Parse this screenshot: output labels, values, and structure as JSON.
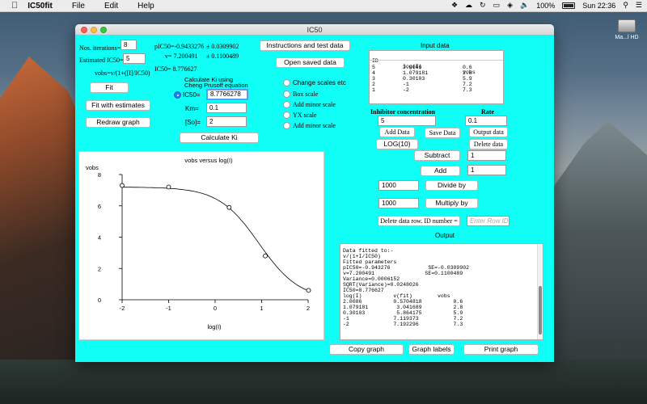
{
  "menubar": {
    "app_name": "IC50fit",
    "menus": [
      "File",
      "Edit",
      "Help"
    ],
    "battery": "100%",
    "clock": "Sun 22:36"
  },
  "desktop": {
    "disk_label": "Ma...l HD"
  },
  "window": {
    "title": "IC50",
    "nos_iterations_label": "Nos. iterations=",
    "nos_iterations_value": "8",
    "est_ic50_label": "Estimated IC50=",
    "est_ic50_value": "5",
    "pic50_text": "pIC50=-0.9433276",
    "pic50_se": "± 0.0309902",
    "v_text": "v= 7.200491",
    "v_se": "± 0.1100489",
    "ic50_text": "IC50= 8.776627",
    "equation": "vobs=v/(1+([I]/IC50)",
    "fit_button": "Fit",
    "fit_estimates_button": "Fit with estimates",
    "redraw_button": "Redraw graph",
    "calc_ki_heading1": "Calculate Ki using",
    "calc_ki_heading2": "Cheng Prusoff equation",
    "ic50_radio_label": "IC50=",
    "ic50_input": "8.7766278",
    "km_label": "Km=",
    "km_input": "0.1",
    "so_label": "[So]=",
    "so_input": "2",
    "calc_ki_button": "Calculate Ki",
    "instructions_button": "Instructions and test data",
    "open_saved_button": "Open saved data",
    "options": {
      "change_scales": "Change scales etc",
      "box_scale": "Box scale",
      "add_minor_scale": "Add minor scale",
      "yx_scale": "YX scale",
      "add_minor_scale2": "Add minor scale"
    },
    "input_data_title": "Input data",
    "input_table": {
      "headers": [
        "ID",
        "log(I)",
        "vobs"
      ],
      "rows": [
        [
          "5",
          "2.0086",
          "0.6"
        ],
        [
          "4",
          "1.079181",
          "2.8"
        ],
        [
          "3",
          "0.30103",
          "5.9"
        ],
        [
          "2",
          "-1",
          "7.2"
        ],
        [
          "1",
          "-2",
          "7.3"
        ]
      ]
    },
    "inhibitor_conc_label": "Inhibitor concentration",
    "rate_label": "Rate",
    "inhibitor_input": "5",
    "rate_input": "0.1",
    "add_data_button": "Add Data",
    "save_data_button": "Save Data",
    "output_data_button": "Output data",
    "delete_data_button": "Delete data",
    "log10_button": "LOG(10)",
    "subtract_button": "Subtract",
    "subtract_value": "1",
    "add_button": "Add",
    "add_value": "1",
    "divide_input": "1000",
    "divide_button": "Divide by",
    "multiply_input": "1000",
    "multiply_button": "Multiply by",
    "delete_row_button": "Delete data row. ID number =",
    "row_id_placeholder": "Enter Row ID",
    "output_title": "Output",
    "output_lines": [
      "Data fitted to:-",
      "v/(1+I/IC50)",
      "Fitted parameters",
      "pIC50=-0.943276            SE=-0.0309902",
      "v=7.200491                SE=0.1100489",
      "Variance=0.0006152",
      "SQRT(Variance)=0.0248026",
      "IC50=8.776627",
      "",
      "log(I)          v(fit)        vobs",
      "2.0086          0.5704818          0.6",
      "1.079181         3.041689          2.8",
      "0.30103          5.864175          5.9",
      "-1              7.119373           7.2",
      "-2              7.192296           7.3"
    ],
    "copy_graph_button": "Copy graph",
    "graph_labels_button": "Graph labels",
    "print_graph_button": "Print graph"
  },
  "chart_data": {
    "type": "scatter",
    "title": "vobs versus log(I)",
    "xlabel": "log(I)",
    "ylabel": "vobs",
    "xlim": [
      -2,
      2
    ],
    "ylim": [
      0,
      8
    ],
    "x_ticks": [
      "-2",
      "-1",
      "0",
      "1",
      "2"
    ],
    "y_ticks": [
      "0",
      "2",
      "4",
      "6",
      "8"
    ],
    "points": {
      "x": [
        -2,
        -1,
        0.30103,
        1.079181,
        2.0086
      ],
      "y": [
        7.3,
        7.2,
        5.9,
        2.8,
        0.6
      ]
    },
    "fit": {
      "model": "v/(1+I/IC50)",
      "v": 7.200491,
      "pIC50": -0.9433276
    }
  }
}
